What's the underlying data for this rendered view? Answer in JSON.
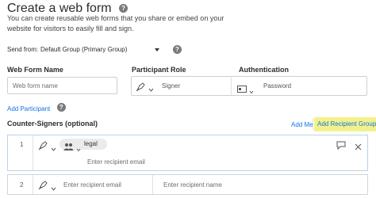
{
  "header": {
    "title": "Create a web form",
    "description": "You can create reusable web forms that you share or embed on your website for visitors to easily fill and sign."
  },
  "send_from": {
    "label": "Send from:",
    "value": "Default Group (Primary Group)"
  },
  "columns": {
    "web_form_name": "Web Form Name",
    "participant_role": "Participant Role",
    "authentication": "Authentication"
  },
  "participant": {
    "name_placeholder": "Web form name",
    "role": "Signer",
    "auth": "Password"
  },
  "add_participant_label": "Add Participant",
  "counter_signers": {
    "heading": "Counter-Signers (optional)",
    "add_me_label": "Add Me",
    "add_group_label": "Add Recipient Group",
    "rows": [
      {
        "number": "1",
        "group_name": "legal",
        "email_placeholder": "Enter recipient email"
      },
      {
        "number": "2",
        "email_placeholder": "Enter recipient email",
        "name_placeholder": "Enter recipient name"
      }
    ]
  },
  "colors": {
    "accent": "#1473e6",
    "highlight": "#f2f28c"
  }
}
